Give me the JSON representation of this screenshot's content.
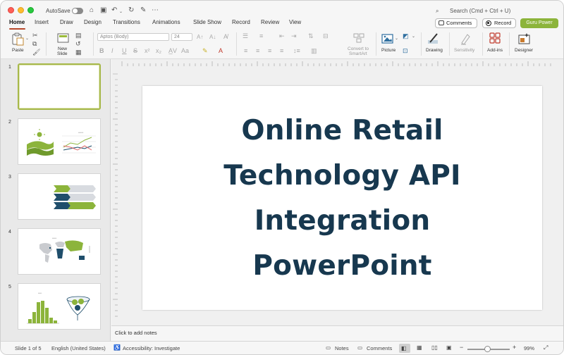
{
  "titlebar": {
    "autosave_label": "AutoSave",
    "search_placeholder": "Search (Cmd + Ctrl + U)"
  },
  "tabs": [
    {
      "label": "Home",
      "active": true
    },
    {
      "label": "Insert"
    },
    {
      "label": "Draw"
    },
    {
      "label": "Design"
    },
    {
      "label": "Transitions"
    },
    {
      "label": "Animations"
    },
    {
      "label": "Slide Show"
    },
    {
      "label": "Record"
    },
    {
      "label": "Review"
    },
    {
      "label": "View"
    }
  ],
  "header_buttons": {
    "comments": "Comments",
    "record": "Record",
    "guru": "Guru Power",
    "guru_color": "#8cb43b"
  },
  "ribbon": {
    "paste": "Paste",
    "new_slide_1": "New",
    "new_slide_2": "Slide",
    "font_name": "Aptos (Body)",
    "font_size": "24",
    "convert_smartart_1": "Convert to",
    "convert_smartart_2": "SmartArt",
    "picture": "Picture",
    "drawing": "Drawing",
    "sensitivity": "Sensitivity",
    "addins": "Add-ins",
    "designer": "Designer"
  },
  "thumbnails": [
    {
      "num": "1",
      "selected": true
    },
    {
      "num": "2"
    },
    {
      "num": "3"
    },
    {
      "num": "4"
    },
    {
      "num": "5"
    }
  ],
  "slide": {
    "title_lines": [
      "Online Retail",
      "Technology API",
      "Integration",
      "PowerPoint"
    ],
    "title_color": "#17384f"
  },
  "notes": {
    "placeholder": "Click to add notes"
  },
  "status": {
    "slide_info": "Slide 1 of 5",
    "language": "English (United States)",
    "accessibility": "Accessibility: Investigate",
    "notes": "Notes",
    "comments": "Comments",
    "zoom": "99%"
  }
}
